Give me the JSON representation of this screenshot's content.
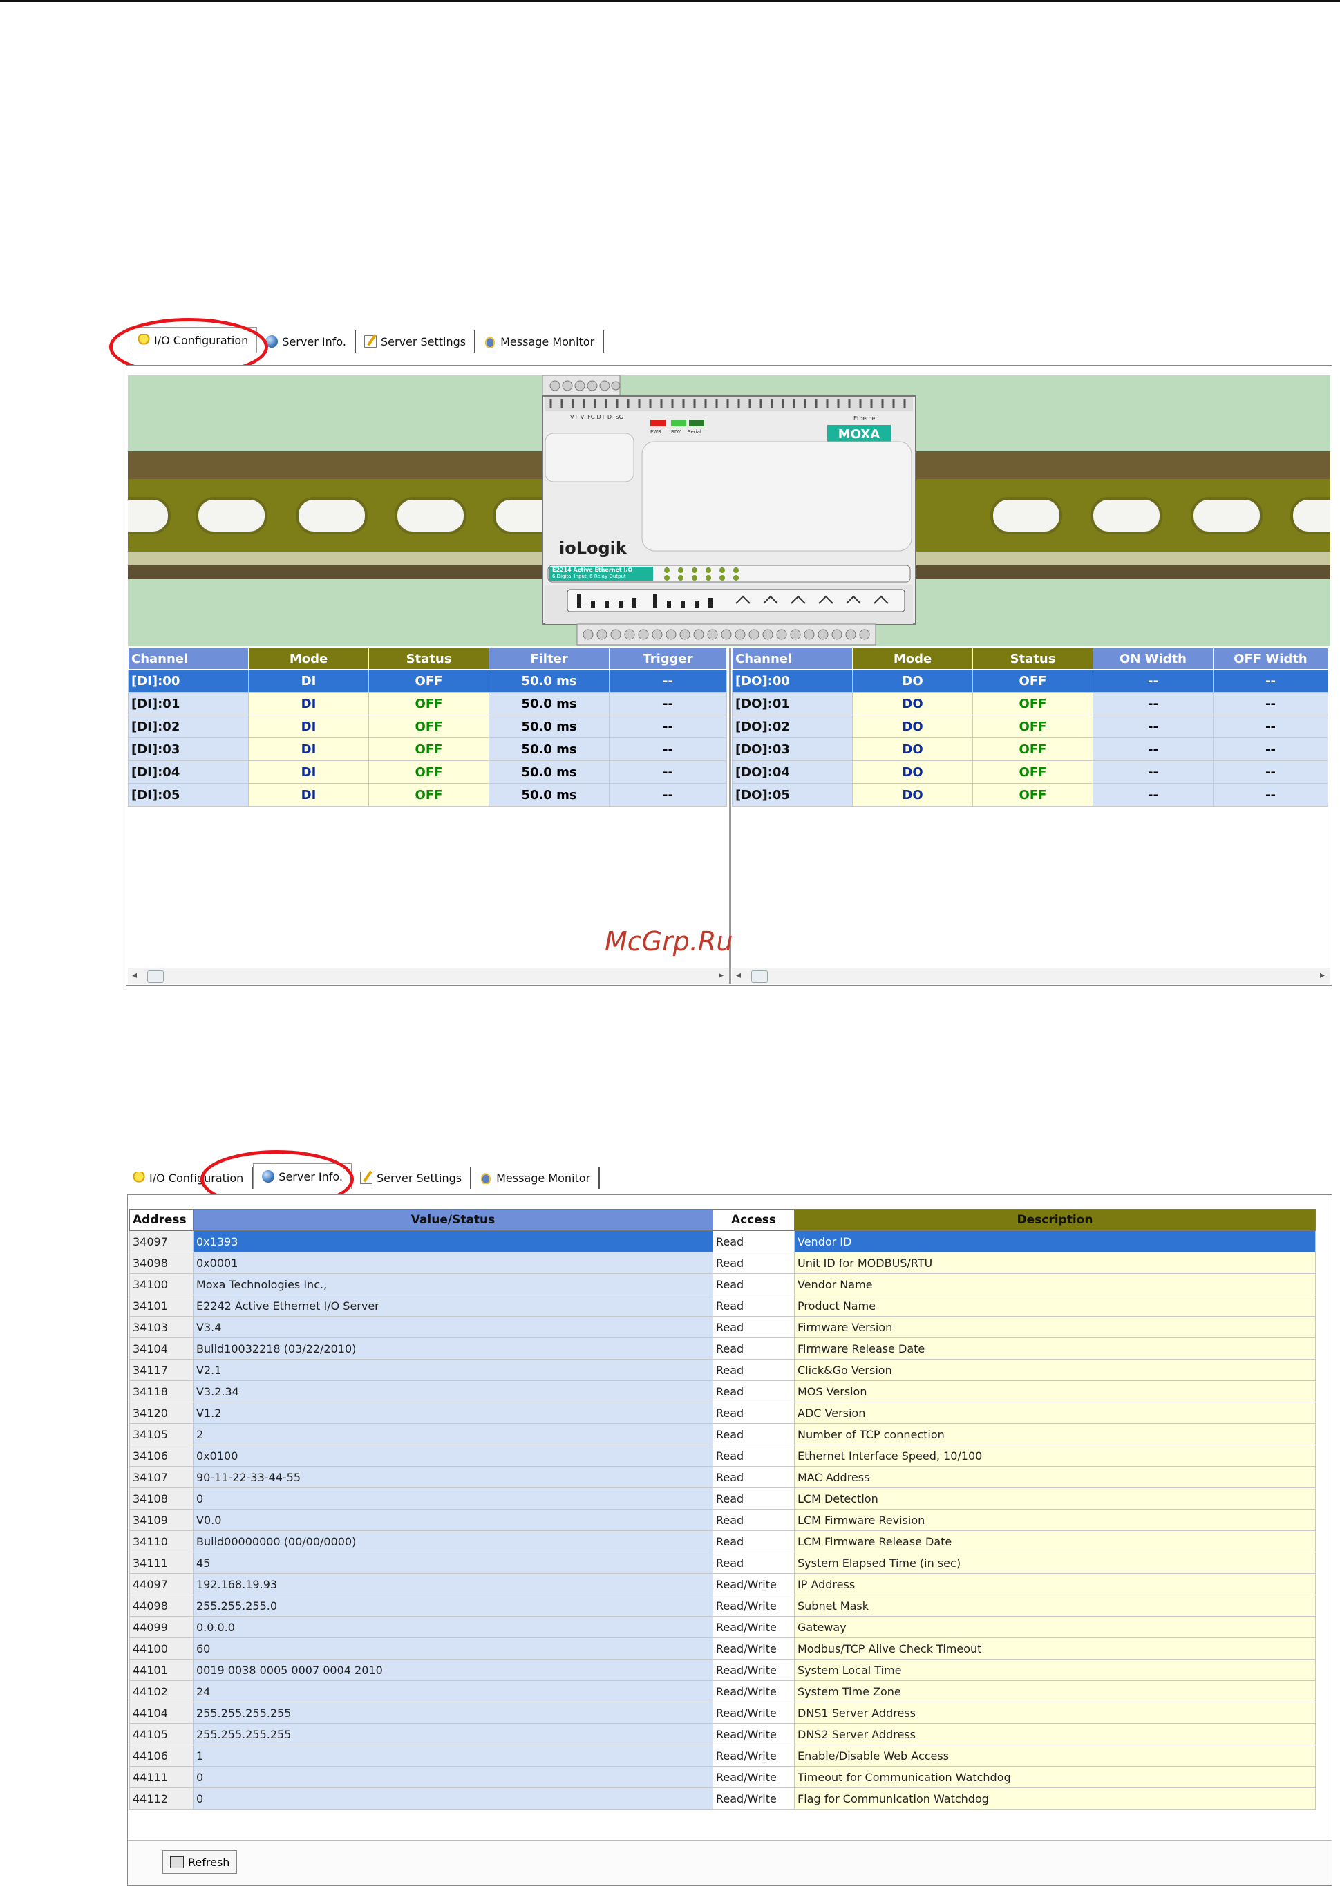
{
  "tabs": [
    {
      "label": "I/O Configuration",
      "icon": "bulb-icon"
    },
    {
      "label": "Server Info.",
      "icon": "globe-icon"
    },
    {
      "label": "Server Settings",
      "icon": "settings-icon"
    },
    {
      "label": "Message Monitor",
      "icon": "monitor-icon"
    }
  ],
  "device": {
    "brand": "MOXA",
    "product_name": "ioLogik",
    "model_line": "E2214 Active Ethernet I/O",
    "model_sub": "6 Digital Input, 6 Relay Output",
    "port_label": "Ethernet",
    "leds": [
      "PWR",
      "RDY",
      "Serial"
    ],
    "terminal_labels": "V+  V-  FG  D+  D-  SG"
  },
  "di_table": {
    "headers": [
      "Channel",
      "Mode",
      "Status",
      "Filter",
      "Trigger"
    ],
    "rows": [
      [
        "[DI]:00",
        "DI",
        "OFF",
        "50.0 ms",
        "--"
      ],
      [
        "[DI]:01",
        "DI",
        "OFF",
        "50.0 ms",
        "--"
      ],
      [
        "[DI]:02",
        "DI",
        "OFF",
        "50.0 ms",
        "--"
      ],
      [
        "[DI]:03",
        "DI",
        "OFF",
        "50.0 ms",
        "--"
      ],
      [
        "[DI]:04",
        "DI",
        "OFF",
        "50.0 ms",
        "--"
      ],
      [
        "[DI]:05",
        "DI",
        "OFF",
        "50.0 ms",
        "--"
      ]
    ]
  },
  "do_table": {
    "headers": [
      "Channel",
      "Mode",
      "Status",
      "ON Width",
      "OFF Width"
    ],
    "rows": [
      [
        "[DO]:00",
        "DO",
        "OFF",
        "--",
        "--"
      ],
      [
        "[DO]:01",
        "DO",
        "OFF",
        "--",
        "--"
      ],
      [
        "[DO]:02",
        "DO",
        "OFF",
        "--",
        "--"
      ],
      [
        "[DO]:03",
        "DO",
        "OFF",
        "--",
        "--"
      ],
      [
        "[DO]:04",
        "DO",
        "OFF",
        "--",
        "--"
      ],
      [
        "[DO]:05",
        "DO",
        "OFF",
        "--",
        "--"
      ]
    ]
  },
  "watermark": "McGrp.Ru",
  "server_table": {
    "headers": [
      "Address",
      "Value/Status",
      "Access",
      "Description"
    ],
    "rows": [
      [
        "34097",
        "0x1393",
        "Read",
        "Vendor ID"
      ],
      [
        "34098",
        "0x0001",
        "Read",
        "Unit ID for MODBUS/RTU"
      ],
      [
        "34100",
        "Moxa Technologies Inc.,",
        "Read",
        "Vendor Name"
      ],
      [
        "34101",
        "E2242 Active Ethernet I/O Server",
        "Read",
        "Product Name"
      ],
      [
        "34103",
        "V3.4",
        "Read",
        "Firmware Version"
      ],
      [
        "34104",
        "Build10032218 (03/22/2010)",
        "Read",
        "Firmware Release Date"
      ],
      [
        "34117",
        "V2.1",
        "Read",
        "Click&Go Version"
      ],
      [
        "34118",
        "V3.2.34",
        "Read",
        "MOS Version"
      ],
      [
        "34120",
        "V1.2",
        "Read",
        "ADC Version"
      ],
      [
        "34105",
        "2",
        "Read",
        "Number of TCP connection"
      ],
      [
        "34106",
        "0x0100",
        "Read",
        "Ethernet Interface Speed, 10/100"
      ],
      [
        "34107",
        "90-11-22-33-44-55",
        "Read",
        "MAC Address"
      ],
      [
        "34108",
        "0",
        "Read",
        "LCM Detection"
      ],
      [
        "34109",
        "V0.0",
        "Read",
        "LCM Firmware Revision"
      ],
      [
        "34110",
        "Build00000000 (00/00/0000)",
        "Read",
        "LCM Firmware Release Date"
      ],
      [
        "34111",
        "45",
        "Read",
        "System Elapsed Time (in sec)"
      ],
      [
        "44097",
        "192.168.19.93",
        "Read/Write",
        "IP Address"
      ],
      [
        "44098",
        "255.255.255.0",
        "Read/Write",
        "Subnet Mask"
      ],
      [
        "44099",
        "0.0.0.0",
        "Read/Write",
        "Gateway"
      ],
      [
        "44100",
        "60",
        "Read/Write",
        "Modbus/TCP Alive Check Timeout"
      ],
      [
        "44101",
        "0019 0038 0005 0007 0004 2010",
        "Read/Write",
        "System Local Time"
      ],
      [
        "44102",
        "24",
        "Read/Write",
        "System Time Zone"
      ],
      [
        "44104",
        "255.255.255.255",
        "Read/Write",
        "DNS1 Server Address"
      ],
      [
        "44105",
        "255.255.255.255",
        "Read/Write",
        "DNS2 Server Address"
      ],
      [
        "44106",
        "1",
        "Read/Write",
        "Enable/Disable Web Access"
      ],
      [
        "44111",
        "0",
        "Read/Write",
        "Timeout for Communication Watchdog"
      ],
      [
        "44112",
        "0",
        "Read/Write",
        "Flag for Communication Watchdog"
      ]
    ]
  },
  "refresh_label": "Refresh",
  "colors": {
    "header_blue": "#6f8fd8",
    "header_olive": "#7a7a10",
    "selected_row": "#2f73d3",
    "highlight_ellipse": "#e8141b"
  }
}
